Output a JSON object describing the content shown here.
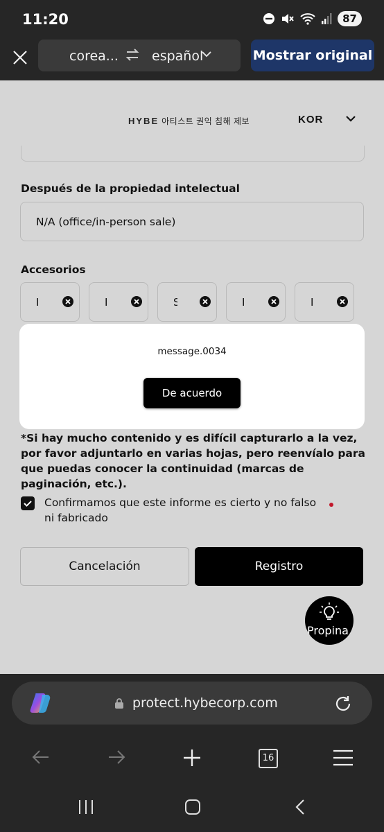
{
  "status_bar": {
    "time": "11:20",
    "battery": "87"
  },
  "translate_bar": {
    "source_lang": "corea...",
    "target_lang": "español",
    "show_original_label": "Mostrar original"
  },
  "site_header": {
    "brand": "HYBE",
    "brand_subtitle": "아티스트 권익 침해 제보",
    "language": "KOR"
  },
  "form": {
    "ip_label": "Después de la propiedad intelectual",
    "ip_value": "N/A (office/in-person sale)",
    "accessories_label": "Accesorios",
    "accessories": [
      "I",
      "I",
      "S",
      "I",
      "I"
    ],
    "note": "*Si hay mucho contenido y es difícil capturarlo a la vez, por favor adjuntarlo en varias hojas, pero reenvíalo para que puedas conocer la continuidad (marcas de paginación, etc.).",
    "confirm_text": "Confirmamos que este informe es cierto y no falso ni fabricado",
    "cancel_label": "Cancelación",
    "register_label": "Registro"
  },
  "tip_button_label": "Propina",
  "modal": {
    "message": "message.0034",
    "ok_label": "De acuerdo"
  },
  "browser": {
    "url": "protect.hybecorp.com",
    "tab_count": "16"
  },
  "colors": {
    "status_bg": "#262626",
    "show_original_bg": "#1e3668",
    "required_dot": "#c2182b"
  }
}
